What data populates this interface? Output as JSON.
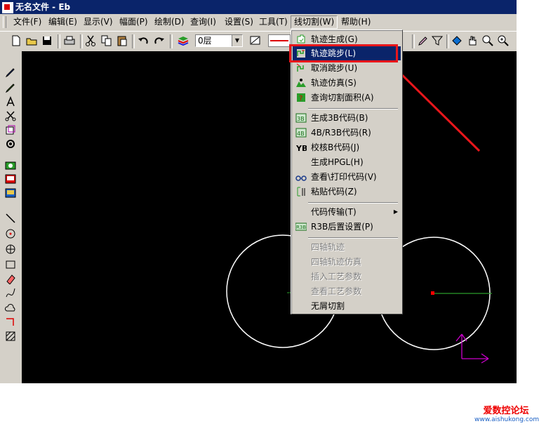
{
  "window": {
    "title": "无名文件 - Eb"
  },
  "menubar": [
    {
      "label": "文件(F)"
    },
    {
      "label": "编辑(E)"
    },
    {
      "label": "显示(V)"
    },
    {
      "label": "幅面(P)"
    },
    {
      "label": "绘制(D)"
    },
    {
      "label": "查询(I)"
    },
    {
      "label": "设置(S)"
    },
    {
      "label": "工具(T)"
    },
    {
      "label": "线切割(W)"
    },
    {
      "label": "帮助(H)"
    }
  ],
  "toolbar": {
    "layer_select": "0层"
  },
  "dropdown_menu": {
    "items": [
      {
        "label": "轨迹生成(G)",
        "icon": "track-generate-icon",
        "state": "normal"
      },
      {
        "label": "轨迹跳步(L)",
        "icon": "track-jump-icon",
        "state": "selected"
      },
      {
        "label": "取消跳步(U)",
        "icon": "cancel-jump-icon",
        "state": "normal"
      },
      {
        "label": "轨迹仿真(S)",
        "icon": "track-simulate-icon",
        "state": "normal"
      },
      {
        "label": "查询切割面积(A)",
        "icon": "query-area-icon",
        "state": "normal"
      },
      {
        "label": "生成3B代码(B)",
        "icon": "code-3b-icon",
        "state": "normal"
      },
      {
        "label": "4B/R3B代码(R)",
        "icon": "code-4b-icon",
        "state": "normal"
      },
      {
        "label": "校核B代码(J)",
        "icon": "verify-b-icon",
        "state": "normal"
      },
      {
        "label": "生成HPGL(H)",
        "icon": "",
        "state": "normal"
      },
      {
        "label": "查看\\打印代码(V)",
        "icon": "glasses-icon",
        "state": "normal"
      },
      {
        "label": "粘贴代码(Z)",
        "icon": "paste-code-icon",
        "state": "normal"
      },
      {
        "label": "代码传输(T)",
        "icon": "",
        "state": "submenu"
      },
      {
        "label": "R3B后置设置(P)",
        "icon": "r3b-settings-icon",
        "state": "normal"
      },
      {
        "label": "四轴轨迹",
        "icon": "",
        "state": "disabled"
      },
      {
        "label": "四轴轨迹仿真",
        "icon": "",
        "state": "disabled"
      },
      {
        "label": "插入工艺参数",
        "icon": "",
        "state": "disabled"
      },
      {
        "label": "查看工艺参数",
        "icon": "",
        "state": "disabled"
      },
      {
        "label": "无屑切割",
        "icon": "",
        "state": "normal"
      }
    ]
  },
  "colors": {
    "title_bar": "#0a246a",
    "canvas": "#000000",
    "annotation": "#e8161b",
    "axis": "#cc00cc"
  },
  "watermark": {
    "line1": "爱数控论坛",
    "line2": "www.aishukong.com"
  }
}
